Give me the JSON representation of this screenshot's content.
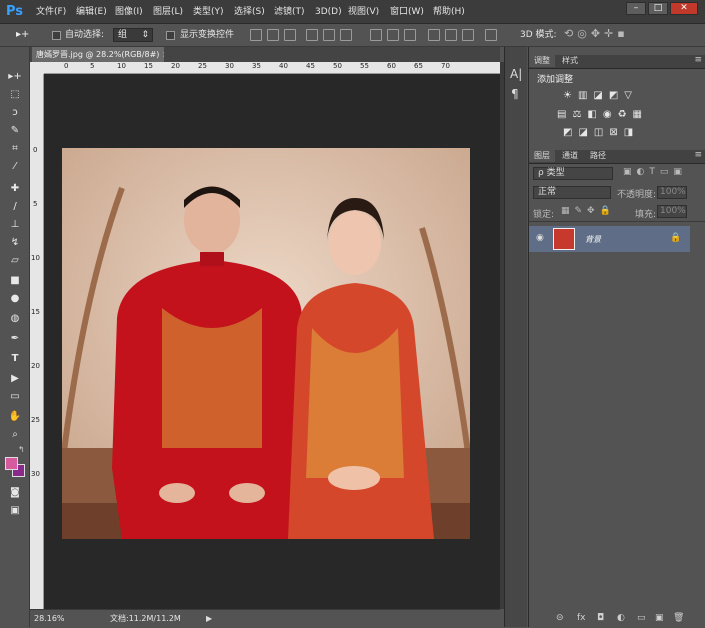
{
  "menubar": {
    "logo": "Ps",
    "items": [
      "文件(F)",
      "编辑(E)",
      "图像(I)",
      "图层(L)",
      "类型(Y)",
      "选择(S)",
      "滤镜(T)",
      "3D(D)",
      "视图(V)",
      "窗口(W)",
      "帮助(H)"
    ],
    "window_controls": [
      "–",
      "□",
      "✕"
    ]
  },
  "options": {
    "auto_select_label": "自动选择:",
    "auto_select_value": "组",
    "show_transform_label": "显示变换控件",
    "mode_3d_label": "3D 模式:"
  },
  "document": {
    "tab_title": "唐嫣罗晋.jpg @ 28.2%(RGB/8#)",
    "ruler_h": [
      "0",
      "5",
      "10",
      "15",
      "20",
      "25",
      "30",
      "35",
      "40",
      "45",
      "50",
      "55",
      "60",
      "65",
      "70"
    ],
    "ruler_v": [
      "0",
      "5",
      "10",
      "15",
      "20",
      "25",
      "30"
    ]
  },
  "status": {
    "zoom": "28.16%",
    "doc_info": "文档:11.2M/11.2M"
  },
  "panels": {
    "adjust_tabs": [
      "调整",
      "样式"
    ],
    "add_adjustment": "添加调整",
    "layer_tabs": [
      "图层",
      "通道",
      "路径"
    ],
    "filter_kind": "ρ 类型",
    "blend_mode": "正常",
    "opacity_label": "不透明度:",
    "opacity_value": "100%",
    "lock_label": "锁定:",
    "fill_label": "填充:",
    "fill_value": "100%",
    "layer_name": "背景",
    "bottom_icons": [
      "⊝",
      "fx",
      "◘",
      "◐",
      "▭",
      "▣",
      "🗑"
    ]
  },
  "colors": {
    "foreground": "#d65a9e",
    "background": "#8a2a8a",
    "layer_selected": "#5f6e86"
  }
}
